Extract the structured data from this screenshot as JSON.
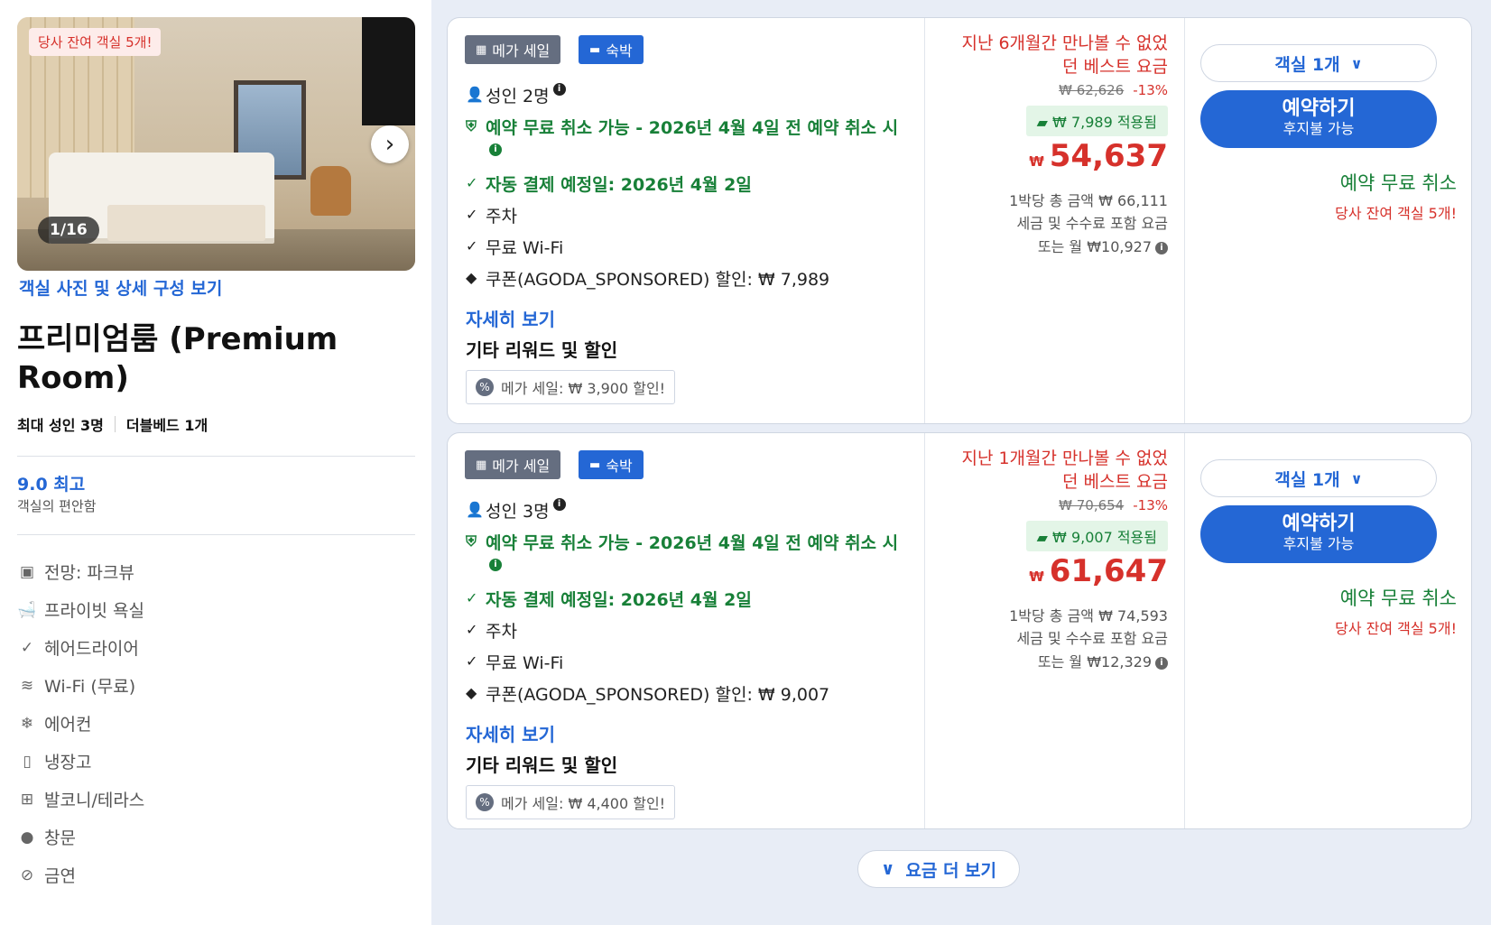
{
  "room": {
    "low_availability_badge": "당사 잔여 객실 5개!",
    "photo_counter": "1/16",
    "photo_link": "객실 사진 및 상세 구성 보기",
    "title": "프리미엄룸 (Premium Room)",
    "max_adults": "최대 성인 3명",
    "bed": "더블베드 1개",
    "score": "9.0 최고",
    "score_sub": "객실의 편안함",
    "amenities": [
      {
        "icon": "view-icon",
        "label": "전망: 파크뷰"
      },
      {
        "icon": "bath-icon",
        "label": "프라이빗 욕실"
      },
      {
        "icon": "check-icon",
        "label": "헤어드라이어"
      },
      {
        "icon": "wifi-icon",
        "label": "Wi-Fi (무료)"
      },
      {
        "icon": "snowflake-icon",
        "label": "에어컨"
      },
      {
        "icon": "fridge-icon",
        "label": "냉장고"
      },
      {
        "icon": "balcony-icon",
        "label": "발코니/테라스"
      },
      {
        "icon": "window-icon",
        "label": "창문"
      },
      {
        "icon": "no-smoking-icon",
        "label": "금연"
      }
    ]
  },
  "offers": [
    {
      "tag_mega": "메가 세일",
      "tag_stay": "숙박",
      "adults": "성인 2명",
      "free_cancel": "예약 무료 취소 가능 - 2026년 4월 4일 전 예약 취소 시",
      "auto_pay": "자동 결제 예정일: 2026년 4월 2일",
      "parking": "주차",
      "wifi": "무료 Wi-Fi",
      "coupon": "쿠폰(AGODA_SPONSORED) 할인: ₩ 7,989",
      "details_link": "자세히 보기",
      "rewards_title": "기타 리워드 및 할인",
      "promo": "메가 세일: ₩ 3,900 할인!",
      "best_price_line1": "지난 6개월간 만나볼 수 없었",
      "best_price_line2": "던 베스트 요금",
      "original_price": "₩ 62,626",
      "discount_pct": "-13%",
      "coupon_applied": "₩ 7,989 적용됨",
      "currency": "₩",
      "price": "54,637",
      "per_night_total": "1박당 총 금액 ₩ 66,111",
      "tax_note": "세금 및 수수료 포함 요금",
      "monthly": "또는 월 ₩10,927",
      "rooms_select": "객실 1개",
      "book_label": "예약하기",
      "book_sub": "후지불 가능",
      "free_cancel_short": "예약 무료 취소",
      "low_rooms": "당사 잔여 객실 5개!"
    },
    {
      "tag_mega": "메가 세일",
      "tag_stay": "숙박",
      "adults": "성인 3명",
      "free_cancel": "예약 무료 취소 가능 - 2026년 4월 4일 전 예약 취소 시",
      "auto_pay": "자동 결제 예정일: 2026년 4월 2일",
      "parking": "주차",
      "wifi": "무료 Wi-Fi",
      "coupon": "쿠폰(AGODA_SPONSORED) 할인: ₩ 9,007",
      "details_link": "자세히 보기",
      "rewards_title": "기타 리워드 및 할인",
      "promo": "메가 세일: ₩ 4,400 할인!",
      "best_price_line1": "지난 1개월간 만나볼 수 없었",
      "best_price_line2": "던 베스트 요금",
      "original_price": "₩ 70,654",
      "discount_pct": "-13%",
      "coupon_applied": "₩ 9,007 적용됨",
      "currency": "₩",
      "price": "61,647",
      "per_night_total": "1박당 총 금액 ₩ 74,593",
      "tax_note": "세금 및 수수료 포함 요금",
      "monthly": "또는 월 ₩12,329",
      "rooms_select": "객실 1개",
      "book_label": "예약하기",
      "book_sub": "후지불 가능",
      "free_cancel_short": "예약 무료 취소",
      "low_rooms": "당사 잔여 객실 5개!"
    }
  ],
  "more_prices": "요금 더 보기"
}
